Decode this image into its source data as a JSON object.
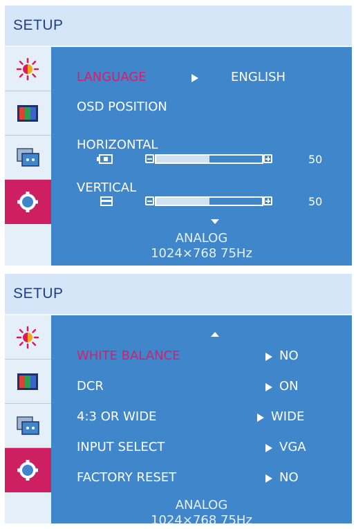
{
  "panel1": {
    "title": "SETUP",
    "menu": {
      "language_label": "LANGUAGE",
      "language_value": "ENGLISH",
      "osd_position_label": "OSD POSITION",
      "horizontal_label": "HORIZONTAL",
      "horizontal_value": "50",
      "horizontal_level": 0.5,
      "vertical_label": "VERTICAL",
      "vertical_value": "50",
      "vertical_level": 0.5
    },
    "footer": {
      "line1": "ANALOG",
      "line2": "1024×768   75Hz"
    }
  },
  "panel2": {
    "title": "SETUP",
    "items": [
      {
        "label": "WHITE BALANCE",
        "value": "NO",
        "highlighted": true
      },
      {
        "label": "DCR",
        "value": "ON",
        "highlighted": false
      },
      {
        "label": "4:3 OR WIDE",
        "value": "WIDE",
        "highlighted": false
      },
      {
        "label": "INPUT SELECT",
        "value": "VGA",
        "highlighted": false
      },
      {
        "label": "FACTORY RESET",
        "value": "NO",
        "highlighted": false
      }
    ],
    "footer": {
      "line1": "ANALOG",
      "line2": "1024×768   75Hz"
    }
  },
  "sidebar_icons": [
    "brightness-icon",
    "color-bars-icon",
    "picture-image-icon",
    "setup-gear-icon"
  ],
  "colors": {
    "content_bg": "#3f86cb",
    "titlebar_bg": "#d4e6f8",
    "sidebar_bg": "#e4eff8",
    "active_tab": "#cf1f63",
    "highlight_text": "#d81d6b",
    "title_text": "#213f86"
  }
}
